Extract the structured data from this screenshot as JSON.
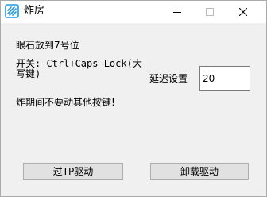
{
  "window": {
    "title": "炸房",
    "icon": "app-grid-icon",
    "controls": {
      "minimize_icon": "minimize-icon",
      "maximize_icon": "maximize-icon",
      "close_icon": "close-icon"
    }
  },
  "main": {
    "instruction": "眼石放到7号位",
    "hotkey_label": "开关: Ctrl+Caps Lock(大写键)",
    "delay_label": "延迟设置",
    "delay_value": "20",
    "warning": "炸期间不要动其他按键!"
  },
  "buttons": {
    "driver_label": "过TP驱动",
    "uninstall_label": "卸载驱动"
  },
  "colors": {
    "accent": "#1e9be0",
    "title_bar": "#ffffff",
    "window_bg": "#f0f0f0",
    "button_bg": "#e1e1e1"
  }
}
